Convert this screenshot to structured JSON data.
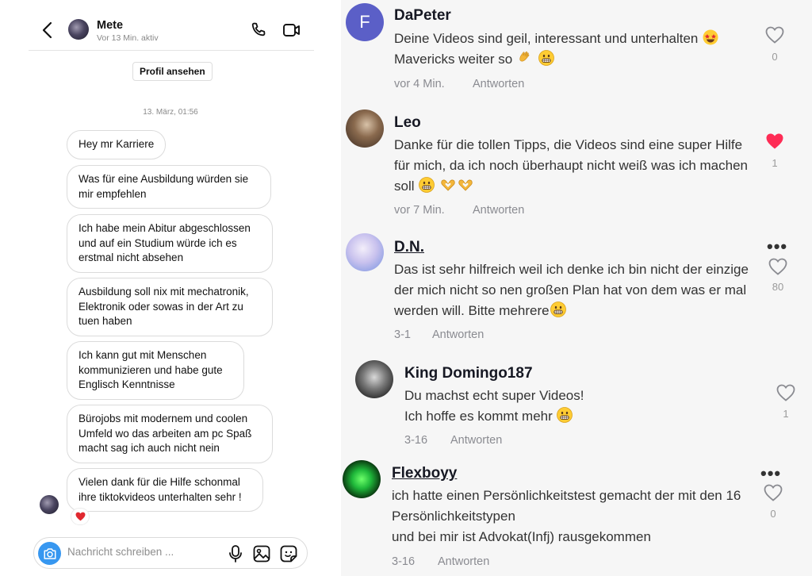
{
  "dm": {
    "contact_name": "Mete",
    "status": "Vor 13 Min. aktiv",
    "profile_button": "Profil ansehen",
    "date_separator": "13. März, 01:56",
    "messages": [
      "Hey mr Karriere",
      "Was für eine Ausbildung würden sie mir empfehlen",
      "Ich habe mein Abitur abgeschlossen und auf ein Studium würde ich es erstmal nicht absehen",
      "Ausbildung soll nix mit mechatronik, Elektronik oder sowas in der Art zu tuen haben",
      "Ich kann gut mit Menschen kommunizieren und habe gute Englisch Kenntnisse",
      "Bürojobs mit modernem und coolen Umfeld wo das arbeiten am pc Spaß macht sag ich auch nicht nein",
      "Vielen dank für die Hilfe schonmal ihre tiktokvideos unterhalten sehr !"
    ],
    "composer_placeholder": "Nachricht schreiben ...",
    "icons": [
      "back-arrow-icon",
      "phone-icon",
      "video-camera-icon",
      "camera-icon",
      "microphone-icon",
      "gallery-icon",
      "sticker-icon",
      "red-heart-reaction-icon"
    ],
    "accent_color": "#3797f0"
  },
  "comments": [
    {
      "author": "DaPeter",
      "avatar_letter": "F",
      "avatar_color": "#5b5fc7",
      "text_parts": [
        "Deine Videos sind geil, interessant und unterhalten ",
        "grinning-face-with-star-eyes-emoji",
        " Mavericks weiter so ",
        "clapping-hands-emoji",
        " ",
        "grinning-face-emoji"
      ],
      "meta": "vor 4 Min.",
      "reply": "Antworten",
      "likes": "0",
      "liked": false
    },
    {
      "author": "Leo",
      "text_parts": [
        "Danke für die tollen Tipps, die Videos sind eine super Hilfe für mich, da ich noch überhaupt nicht weiß was ich machen soll ",
        "grinning-face-emoji",
        " ",
        "heart-hands-emoji",
        "heart-hands-emoji"
      ],
      "meta": "vor 7 Min.",
      "reply": "Antworten",
      "likes": "1",
      "liked": true
    },
    {
      "author": "D.N.",
      "text_parts": [
        "Das ist sehr hilfreich weil ich denke ich bin nicht der einzige der mich nicht so nen großen Plan hat von dem was er mal werden will. Bitte mehrere",
        "grinning-face-emoji"
      ],
      "meta": "3-1",
      "reply": "Antworten",
      "likes": "80",
      "liked": false
    },
    {
      "author": "King Domingo187",
      "text_parts": [
        "Du machst echt super Videos!\nIch hoffe es kommt mehr ",
        "grinning-face-emoji"
      ],
      "meta": "3-16",
      "reply": "Antworten",
      "likes": "1",
      "liked": false
    },
    {
      "author": "Flexboyy",
      "text_parts": [
        "ich hatte einen Persönlichkeitstest gemacht der mit den 16 Persönlichkeitstypen\nund bei mir ist Advokat(Infj) rausgekommen"
      ],
      "meta": "3-16",
      "reply": "Antworten",
      "likes": "0",
      "liked": false
    }
  ],
  "comment_icons": [
    "heart-outline-icon",
    "heart-filled-icon",
    "more-options-icon"
  ],
  "liked_color": "#fe2c55"
}
